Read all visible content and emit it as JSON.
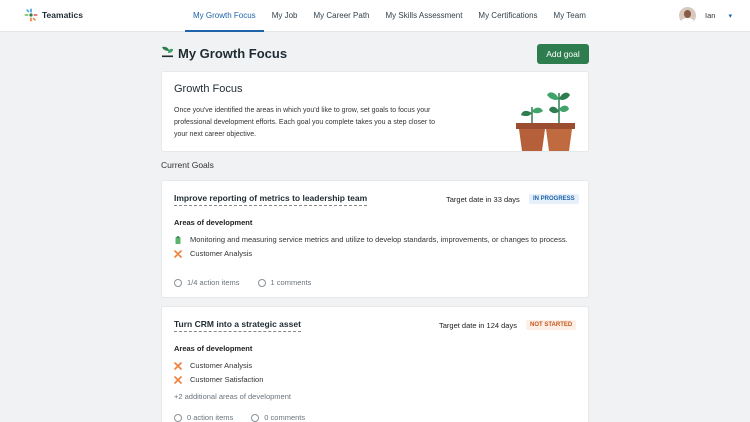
{
  "brand": {
    "name": "Teamatics"
  },
  "nav": {
    "items": [
      {
        "label": "My Growth Focus",
        "active": true
      },
      {
        "label": "My Job"
      },
      {
        "label": "My Career Path"
      },
      {
        "label": "My Skills Assessment"
      },
      {
        "label": "My Certifications"
      },
      {
        "label": "My Team"
      }
    ]
  },
  "user": {
    "name": "Ian"
  },
  "page": {
    "title": "My Growth Focus",
    "add_goal_label": "Add goal"
  },
  "intro": {
    "title": "Growth Focus",
    "text": "Once you've identified the areas in which you'd like to grow, set goals to focus your professional development efforts. Each goal you complete takes you a step closer to your next career objective."
  },
  "current_goals_label": "Current Goals",
  "goals": [
    {
      "title": "Improve reporting of metrics to leadership team",
      "target": "Target date in 33 days",
      "status": "IN PROGRESS",
      "areas_heading": "Areas of development",
      "areas": [
        "Monitoring and measuring service metrics and utilize to develop standards, improvements, or changes to process.",
        "Customer Analysis"
      ],
      "action_items": "1/4 action items",
      "comments": "1 comments"
    },
    {
      "title": "Turn CRM into a strategic asset",
      "target": "Target date in 124 days",
      "status": "NOT STARTED",
      "areas_heading": "Areas of development",
      "areas": [
        "Customer Analysis",
        "Customer Satisfaction"
      ],
      "extra_areas": "+2 additional areas of development",
      "action_items": "0 action items",
      "comments": "0 comments"
    }
  ],
  "colors": {
    "accent": "#1f63a8",
    "primary_button": "#2e7d4f",
    "in_progress": "#1f63a8",
    "not_started": "#c2571d"
  }
}
